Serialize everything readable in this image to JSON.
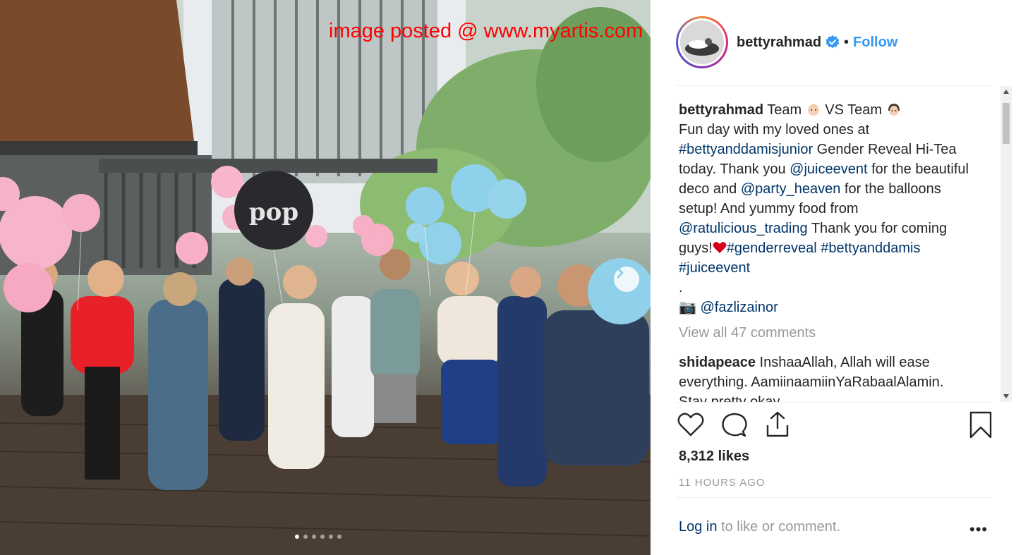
{
  "watermark": "image posted @ www.myartis.com",
  "carousel": {
    "slide_count": 6,
    "active_index": 0
  },
  "post": {
    "username": "bettyrahmad",
    "separator": "•",
    "follow_label": "Follow",
    "caption": {
      "user": "bettyrahmad",
      "line_1a": "Team ",
      "line_1b": " VS Team ",
      "line_2": "Fun day with my loved ones at ",
      "tag_1": "#bettyanddamisjunior",
      "text_1": " Gender Reveal Hi-Tea today. Thank you ",
      "mention_1": "@juiceevent",
      "text_2": " for the beautiful deco and ",
      "mention_2": "@party_heaven",
      "text_3": " for the balloons setup! And yummy food from ",
      "mention_3": "@ratulicious_trading",
      "text_4": " Thank you for coming guys!",
      "tag_2": "#genderreveal",
      "tag_3": "#bettyanddamis",
      "tag_4": "#juiceevent",
      "dot_line": ".",
      "camera_glyph": "📷",
      "mention_4": "@fazlizainor"
    },
    "view_all_comments": "View all 47 comments",
    "comments": [
      {
        "user": "shidapeace",
        "text": " InshaaAllah, Allah will ease everything. AamiinaamiinYaRabaalAlamin. Stay pretty okay"
      }
    ],
    "likes": "8,312 likes",
    "timestamp": "11 HOURS AGO",
    "footer": {
      "login": "Log in",
      "rest": " to like or comment."
    },
    "more_label": "•••"
  },
  "colors": {
    "link": "#003569",
    "follow": "#3897f0",
    "muted": "#999999",
    "text": "#262626",
    "watermark": "#ff0000"
  },
  "icons": [
    "heart-icon",
    "comment-icon",
    "share-icon",
    "bookmark-icon",
    "verified-badge-icon",
    "chevron-right-icon",
    "camera-icon"
  ]
}
